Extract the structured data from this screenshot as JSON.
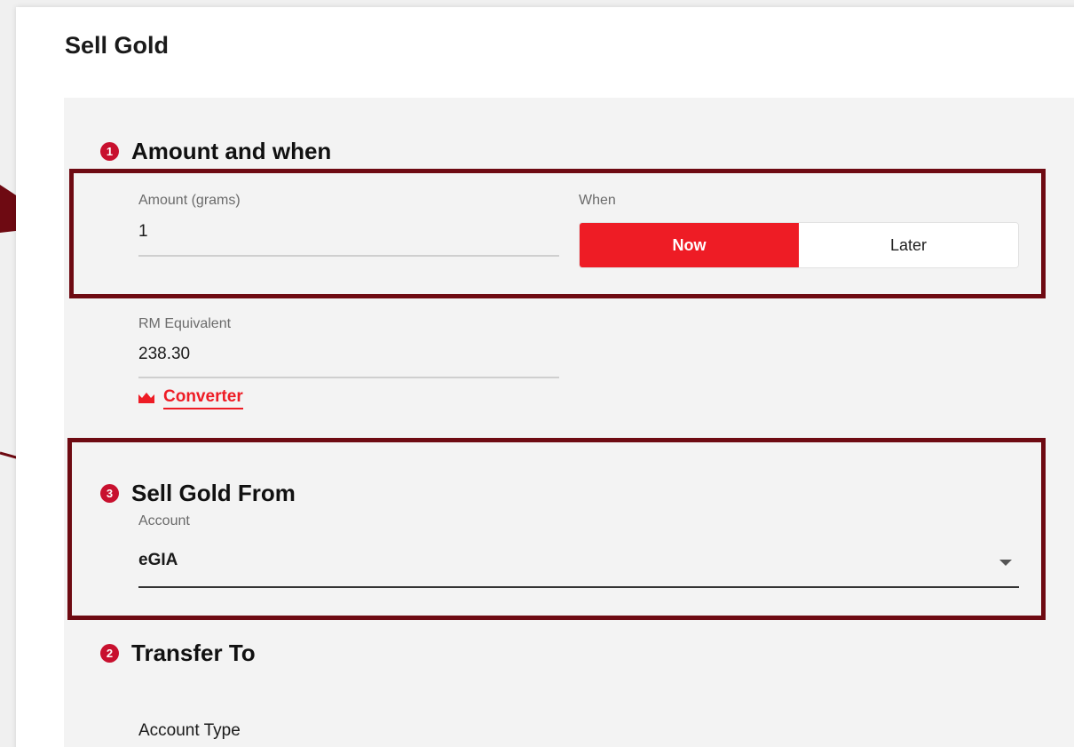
{
  "page": {
    "title": "Sell Gold"
  },
  "sections": {
    "amount_when": {
      "step": "1",
      "title": "Amount and when",
      "amount_label": "Amount (grams)",
      "amount_value": "1",
      "when_label": "When",
      "when_options": [
        "Now",
        "Later"
      ],
      "when_selected": "Now",
      "rm_label": "RM Equivalent",
      "rm_value": "238.30",
      "converter_label": "Converter",
      "converter_icon": "converter-icon"
    },
    "sell_from": {
      "step": "3",
      "title": "Sell Gold From",
      "account_label": "Account",
      "account_value": "eGIA",
      "dropdown_icon": "chevron-down-icon"
    },
    "transfer_to": {
      "step": "2",
      "title": "Transfer To",
      "account_type_label": "Account Type"
    }
  },
  "colors": {
    "accent": "#ee1c25",
    "badge": "#c8102e",
    "annotation": "#6e0a12"
  }
}
